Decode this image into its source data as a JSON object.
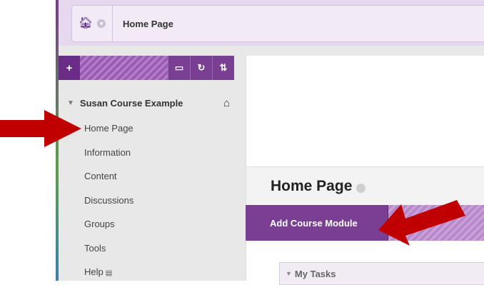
{
  "breadcrumb": {
    "title": "Home Page"
  },
  "sidebar": {
    "toolbar": {
      "add_label": "+",
      "folder_icon": "folder-icon",
      "refresh_icon": "refresh-icon",
      "sort_icon": "sort-icon"
    },
    "course_name": "Susan Course Example",
    "items": [
      {
        "label": "Home Page"
      },
      {
        "label": "Information"
      },
      {
        "label": "Content"
      },
      {
        "label": "Discussions"
      },
      {
        "label": "Groups"
      },
      {
        "label": "Tools"
      },
      {
        "label": "Help"
      }
    ]
  },
  "main": {
    "page_title": "Home Page",
    "add_module_label": "Add Course Module",
    "module_title": "My Tasks"
  },
  "colors": {
    "accent": "#7a3f93",
    "header_bg": "#e6d8ee",
    "arrow": "#c00000"
  }
}
